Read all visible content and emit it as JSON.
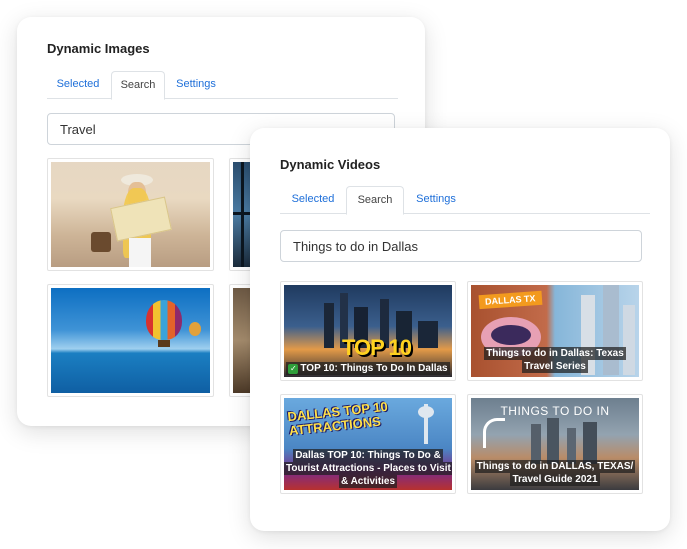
{
  "images_panel": {
    "title": "Dynamic Images",
    "tabs": [
      "Selected",
      "Search",
      "Settings"
    ],
    "active_tab": "Search",
    "search_value": "Travel"
  },
  "videos_panel": {
    "title": "Dynamic Videos",
    "tabs": [
      "Selected",
      "Search",
      "Settings"
    ],
    "active_tab": "Search",
    "search_value": "Things to do in Dallas",
    "videos": [
      {
        "overlay": "TOP 10",
        "caption": "TOP 10: Things To Do In Dallas",
        "selected": true
      },
      {
        "overlay": "DALLAS TX",
        "caption": "Things to do in Dallas: Texas Travel Series",
        "selected": false
      },
      {
        "overlay": "DALLAS TOP 10 ATTRACTIONS",
        "caption": "Dallas TOP 10: Things To Do & Tourist Attractions - Places to Visit & Activities",
        "selected": false
      },
      {
        "overlay": "THINGS TO DO IN",
        "caption": "Things to do in DALLAS, TEXAS/ Travel Guide 2021",
        "selected": false
      }
    ]
  },
  "icons": {
    "selected_check": "check-icon"
  },
  "colors": {
    "accent": "#1e6fd9",
    "check": "#2e9e3a"
  }
}
